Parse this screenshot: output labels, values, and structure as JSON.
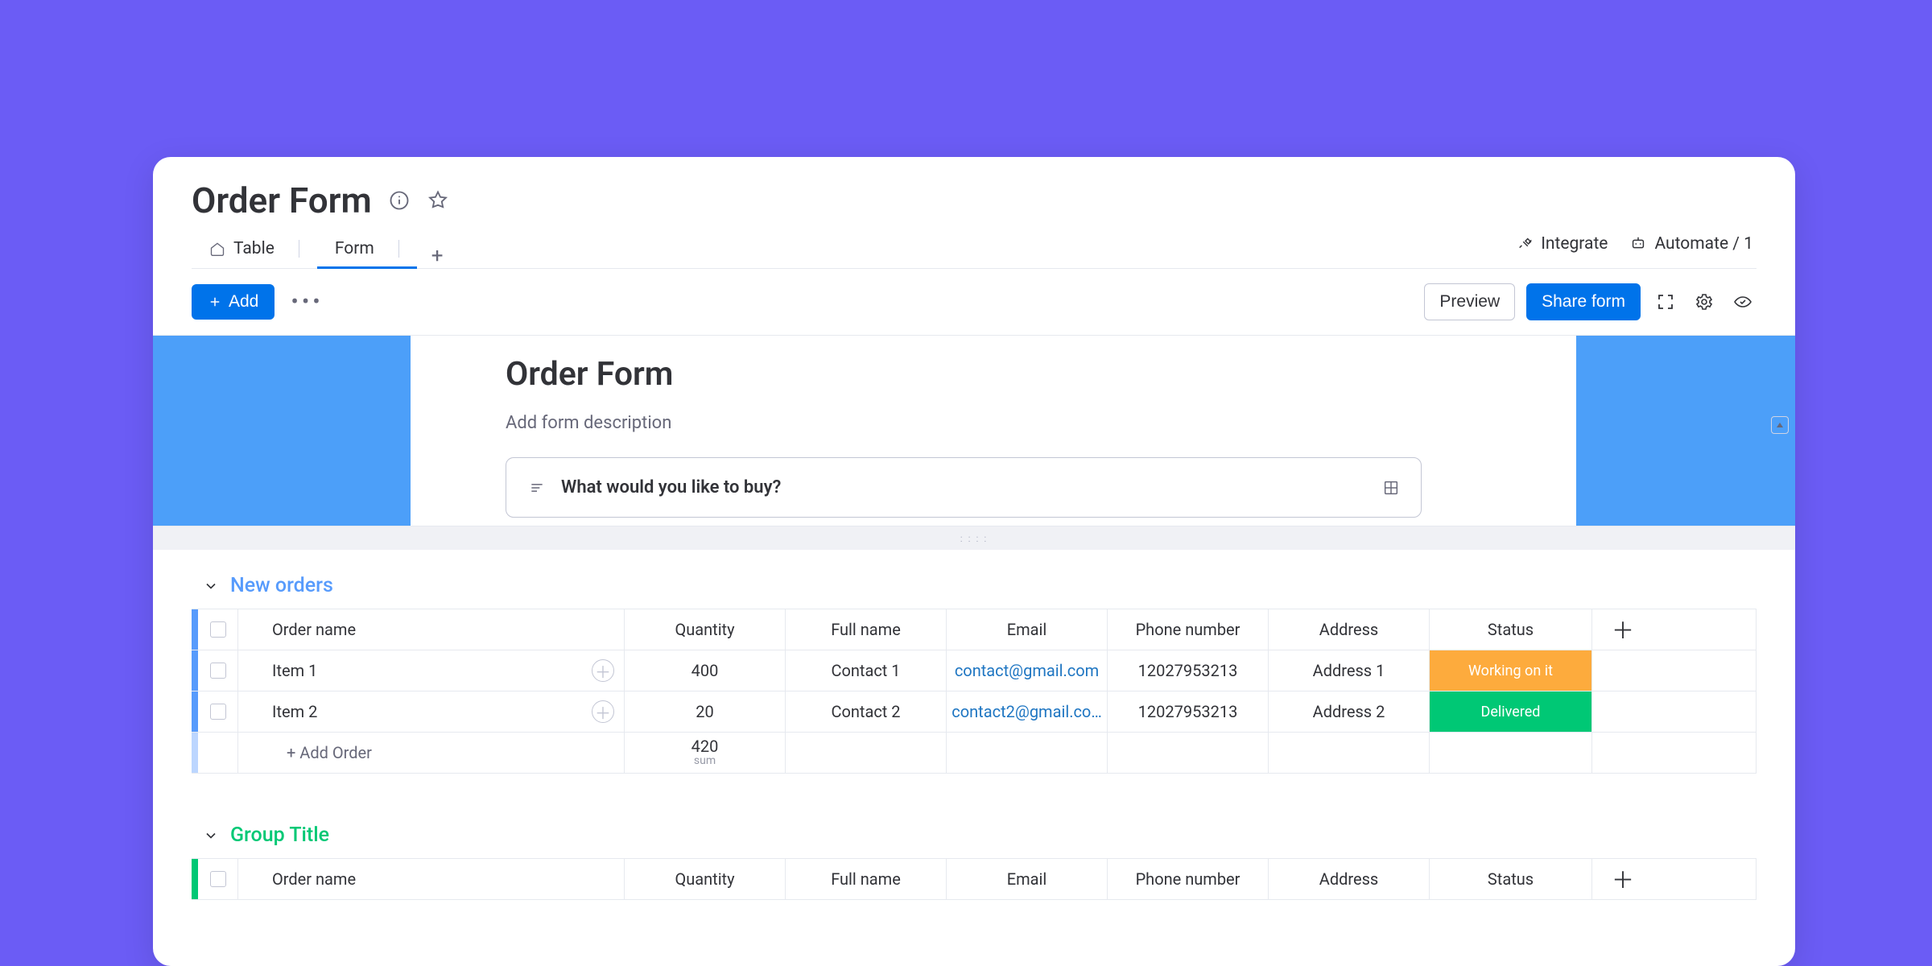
{
  "header": {
    "page_title": "Order Form",
    "tabs": [
      {
        "label": "Table",
        "active": false
      },
      {
        "label": "Form",
        "active": true
      }
    ],
    "integrate_label": "Integrate",
    "automate_label": "Automate / 1",
    "add_label": "Add",
    "preview_label": "Preview",
    "share_label": "Share form"
  },
  "form": {
    "title": "Order Form",
    "description_placeholder": "Add form description",
    "question_text": "What would you like to buy?"
  },
  "columns": {
    "c0": "Order name",
    "c1": "Quantity",
    "c2": "Full name",
    "c3": "Email",
    "c4": "Phone number",
    "c5": "Address",
    "c6": "Status"
  },
  "groups": [
    {
      "title": "New orders",
      "color": "blue",
      "rows": [
        {
          "name": "Item 1",
          "qty": "400",
          "full": "Contact 1",
          "email": "contact@gmail.com",
          "phone": "12027953213",
          "addr": "Address 1",
          "status": "Working on it",
          "status_color": "orange"
        },
        {
          "name": "Item 2",
          "qty": "20",
          "full": "Contact 2",
          "email": "contact2@gmail.co…",
          "phone": "12027953213",
          "addr": "Address 2",
          "status": "Delivered",
          "status_color": "green"
        }
      ],
      "add_row_label": "+ Add Order",
      "sum_value": "420",
      "sum_label": "sum"
    },
    {
      "title": "Group Title",
      "color": "green",
      "rows": [],
      "add_row_label": "",
      "sum_value": "",
      "sum_label": ""
    }
  ]
}
